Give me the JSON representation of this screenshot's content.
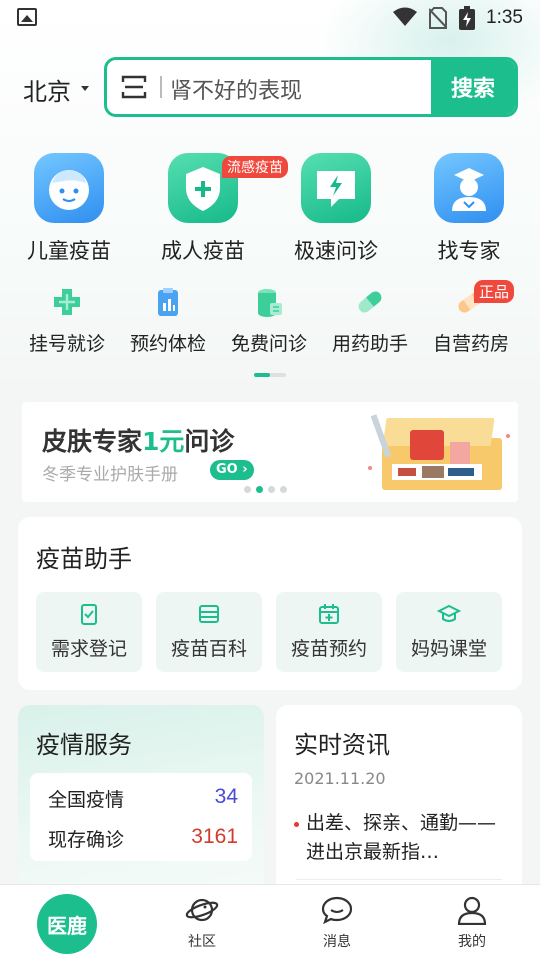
{
  "status_bar": {
    "time": "1:35"
  },
  "header": {
    "city": "北京",
    "search_placeholder": "肾不好的表现",
    "search_button": "搜索"
  },
  "big_services": [
    {
      "label": "儿童疫苗",
      "icon": "child-face-icon"
    },
    {
      "label": "成人疫苗",
      "icon": "shield-plus-icon",
      "tag": "流感疫苗"
    },
    {
      "label": "极速问诊",
      "icon": "lightning-chat-icon"
    },
    {
      "label": "找专家",
      "icon": "doctor-icon"
    }
  ],
  "small_services": [
    {
      "label": "挂号就诊",
      "icon": "medical-cross-icon"
    },
    {
      "label": "预约体检",
      "icon": "clipboard-chart-icon"
    },
    {
      "label": "免费问诊",
      "icon": "cylinder-icon"
    },
    {
      "label": "用药助手",
      "icon": "pill-icon"
    },
    {
      "label": "自营药房",
      "icon": "bandage-icon",
      "tag": "正品"
    }
  ],
  "banner": {
    "title_prefix": "皮肤专家",
    "title_highlight": "1元",
    "title_suffix": "问诊",
    "subtitle": "冬季专业护肤手册",
    "go": "GO"
  },
  "vaccine_helper": {
    "title": "疫苗助手",
    "items": [
      {
        "label": "需求登记",
        "icon": "clipboard-check-icon"
      },
      {
        "label": "疫苗百科",
        "icon": "book-icon"
      },
      {
        "label": "疫苗预约",
        "icon": "calendar-plus-icon"
      },
      {
        "label": "妈妈课堂",
        "icon": "graduation-cap-icon"
      }
    ]
  },
  "epidemic": {
    "title": "疫情服务",
    "rows": [
      {
        "label": "全国疫情",
        "value": "34",
        "color": "#4a4ad6"
      },
      {
        "label": "现存确诊",
        "value": "3161",
        "color": "#d33a2c"
      }
    ]
  },
  "news": {
    "title": "实时资讯",
    "date": "2021.11.20",
    "headline": "出差、探亲、通勤——进出京最新指…"
  },
  "tab_bar": {
    "home": "医鹿",
    "tabs": [
      {
        "label": "社区"
      },
      {
        "label": "消息"
      },
      {
        "label": "我的"
      }
    ]
  },
  "colors": {
    "brand": "#1dbe8e",
    "tag_red": "#f0483c"
  }
}
